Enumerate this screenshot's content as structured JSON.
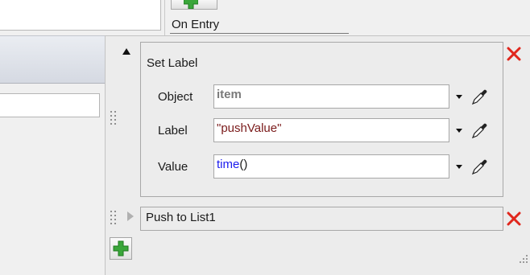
{
  "background": {
    "on_entry_label": "On Entry"
  },
  "set_label": {
    "title": "Set Label",
    "fields": [
      {
        "label": "Object",
        "value": "item"
      },
      {
        "label": "Label",
        "value": "\"pushValue\""
      },
      {
        "label": "Value",
        "value_func": "time",
        "value_parens": "()"
      }
    ]
  },
  "push_to_list": {
    "title": "Push to List1"
  },
  "colors": {
    "keyword_gray": "#7a7a7a",
    "string_dark_red": "#7a1a1a",
    "function_blue": "#1a1aee",
    "delete_red": "#e0271d",
    "plus_green": "#3aa63a"
  },
  "icons": {
    "collapse": "triangle-up-icon",
    "expand": "triangle-right-icon",
    "dropdown": "chevron-down-icon",
    "picker": "eyedropper-icon",
    "delete": "close-icon",
    "add": "plus-icon",
    "drag": "drag-handle-icon",
    "resize": "resize-grip-icon"
  }
}
